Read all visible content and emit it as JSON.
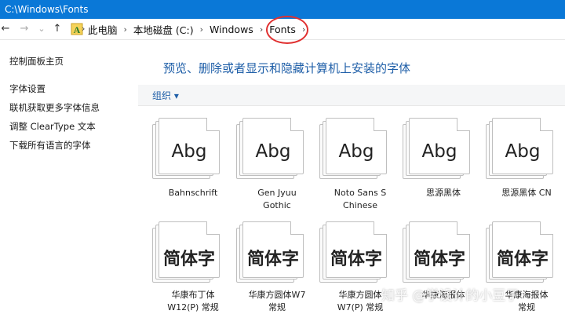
{
  "window": {
    "title": "C:\\Windows\\Fonts"
  },
  "nav": {
    "back": "←",
    "forward": "→",
    "recent": "⌄",
    "up": "↑"
  },
  "address": {
    "crumbs": [
      "此电脑",
      "本地磁盘 (C:)",
      "Windows",
      "Fonts"
    ],
    "separator": "›"
  },
  "sidebar": {
    "items": [
      "控制面板主页",
      "字体设置",
      "联机获取更多字体信息",
      "调整 ClearType 文本",
      "下载所有语言的字体"
    ]
  },
  "main": {
    "heading": "预览、删除或者显示和隐藏计算机上安装的字体",
    "organize_label": "组织 ▾"
  },
  "fonts": [
    {
      "sample": "Abg",
      "name_line1": "Bahnschrift",
      "name_line2": ""
    },
    {
      "sample": "Abg",
      "name_line1": "Gen Jyuu",
      "name_line2": "Gothic"
    },
    {
      "sample": "Abg",
      "name_line1": "Noto Sans S",
      "name_line2": "Chinese"
    },
    {
      "sample": "Abg",
      "name_line1": "思源黑体",
      "name_line2": ""
    },
    {
      "sample": "Abg",
      "name_line1": "思源黑体 CN",
      "name_line2": ""
    },
    {
      "sample": "简体字",
      "name_line1": "华康布丁体",
      "name_line2": "W12(P) 常规"
    },
    {
      "sample": "简体字",
      "name_line1": "华康方圆体W7",
      "name_line2": "常规"
    },
    {
      "sample": "简体字",
      "name_line1": "华康方圆体",
      "name_line2": "W7(P) 常规"
    },
    {
      "sample": "简体字",
      "name_line1": "华康海报体",
      "name_line2": ""
    },
    {
      "sample": "简体字",
      "name_line1": "华康海报体",
      "name_line2": "常规"
    }
  ],
  "watermark": "知乎 @学设计的小豆子",
  "colors": {
    "titlebar": "#0a78d7",
    "link": "#1f5fa8",
    "highlight_circle": "#e03030"
  }
}
